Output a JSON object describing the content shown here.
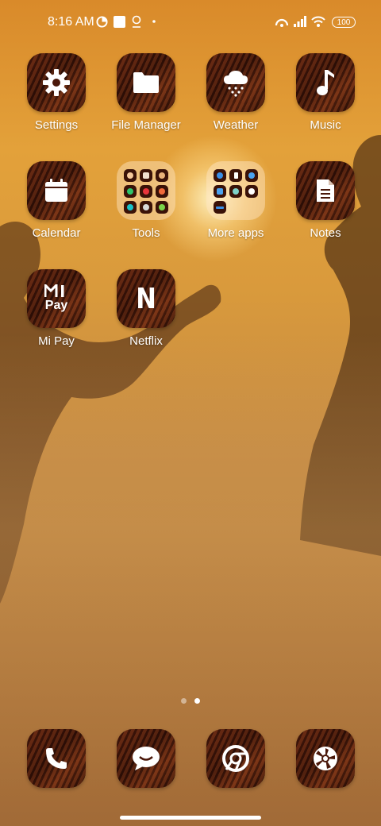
{
  "status_bar": {
    "time": "8:16 AM",
    "left_icons": [
      "data-saver-icon",
      "notification-square-icon",
      "location-pin-icon",
      "dot-icon"
    ],
    "right_icons": [
      "hotspot-icon",
      "signal-icon",
      "wifi-icon"
    ],
    "battery": "100"
  },
  "apps": [
    {
      "label": "Settings",
      "icon": "gear-icon"
    },
    {
      "label": "File Manager",
      "icon": "folder-icon"
    },
    {
      "label": "Weather",
      "icon": "cloud-snow-icon"
    },
    {
      "label": "Music",
      "icon": "music-note-icon"
    },
    {
      "label": "Calendar",
      "icon": "calendar-icon"
    },
    {
      "label": "Tools",
      "icon": "folder-tools-icon"
    },
    {
      "label": "More apps",
      "icon": "folder-more-apps-icon"
    },
    {
      "label": "Notes",
      "icon": "document-icon"
    },
    {
      "label": "Mi Pay",
      "icon": "mi-pay-icon",
      "logo_text": "Pay"
    },
    {
      "label": "Netflix",
      "icon": "netflix-icon",
      "logo_text": "N"
    }
  ],
  "dock": [
    {
      "icon": "phone-icon"
    },
    {
      "icon": "messages-icon"
    },
    {
      "icon": "chrome-icon"
    },
    {
      "icon": "camera-aperture-icon"
    }
  ],
  "page_indicator": {
    "pages": 2,
    "current": 2
  },
  "colors": {
    "accent_white": "#ffffff",
    "icon_wood": "#3a1208"
  }
}
